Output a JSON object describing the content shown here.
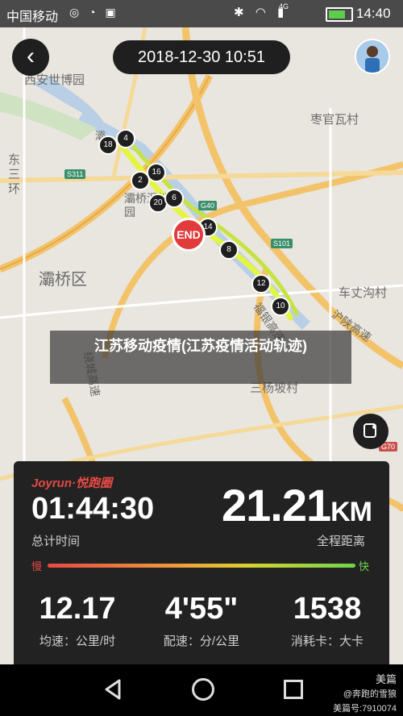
{
  "status_bar": {
    "carrier": "中国移动",
    "status_icons": "◎ ◔ ▣",
    "network": "4G",
    "right_icons": "✱ ◠ ▮",
    "time": "14:40"
  },
  "map": {
    "labels": {
      "xian_expo": "西安世博园",
      "zaoyi": "枣官瓦村",
      "dongsanhuan": "东三环",
      "baqiao_wetland": "灞桥湿地公园",
      "baqiao_district": "灞桥区",
      "chezhang": "车丈沟村",
      "sanyang": "三杨坡村",
      "huyu": "沪陕高速",
      "raocheng": "绕城高速",
      "furong": "福银高速",
      "bashui": "灞"
    },
    "road_badges": [
      "S311",
      "G40",
      "S101",
      "G70"
    ],
    "end_label": "END",
    "km_markers": [
      "4",
      "18",
      "2",
      "16",
      "20",
      "6",
      "14",
      "8",
      "12",
      "10"
    ]
  },
  "header": {
    "back_icon": "‹",
    "datetime": "2018-12-30 10:51"
  },
  "overlay_title": "江苏移动疫情(江苏疫情活动轨迹)",
  "stats": {
    "brand": "Joyrun·悦跑圈",
    "duration": "01:44:30",
    "duration_label": "总计时间",
    "distance": "21.21",
    "distance_unit": "KM",
    "distance_label": "全程距离",
    "slow_label": "慢",
    "fast_label": "快",
    "speed": "12.17",
    "speed_label": "均速：公里/时",
    "pace": "4'55\"",
    "pace_label": "配速：分/公里",
    "calories": "1538",
    "calories_label": "消耗卡：大卡"
  },
  "watermark": {
    "app": "美篇",
    "author": "@奔跑的雪狼",
    "id": "美篇号:7910074"
  },
  "colors": {
    "route": "#e3f542",
    "end_marker": "#e23b3b",
    "accent_red": "#e74a44",
    "accent_green": "#6fd44c"
  }
}
